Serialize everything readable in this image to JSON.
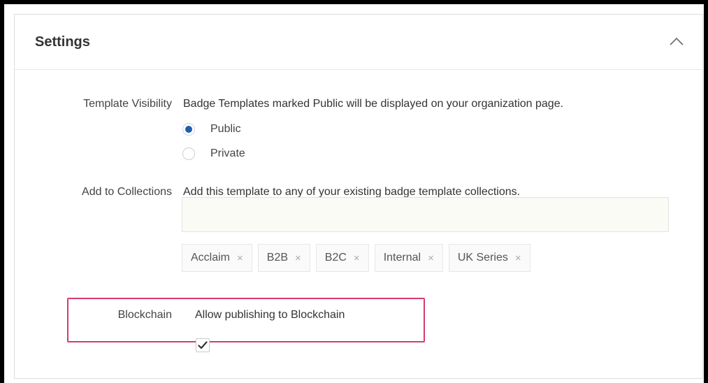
{
  "settings": {
    "title": "Settings",
    "collapse_icon": "chevron-up-icon",
    "template_visibility": {
      "label": "Template Visibility",
      "description": "Badge Templates marked Public will be displayed on your organization page.",
      "options": [
        {
          "label": "Public",
          "selected": true
        },
        {
          "label": "Private",
          "selected": false
        }
      ]
    },
    "collections": {
      "label": "Add to Collections",
      "description": "Add this template to any of your existing badge template collections.",
      "input_value": "",
      "tags": [
        {
          "label": "Acclaim",
          "remove": "×"
        },
        {
          "label": "B2B",
          "remove": "×"
        },
        {
          "label": "B2C",
          "remove": "×"
        },
        {
          "label": "Internal",
          "remove": "×"
        },
        {
          "label": "UK Series",
          "remove": "×"
        }
      ]
    },
    "blockchain": {
      "label": "Blockchain",
      "description": "Allow publishing to Blockchain",
      "checked": true,
      "highlight_color": "#d63c6c"
    }
  },
  "colors": {
    "radio_selected": "#1f5ea8",
    "frame": "#000000"
  }
}
